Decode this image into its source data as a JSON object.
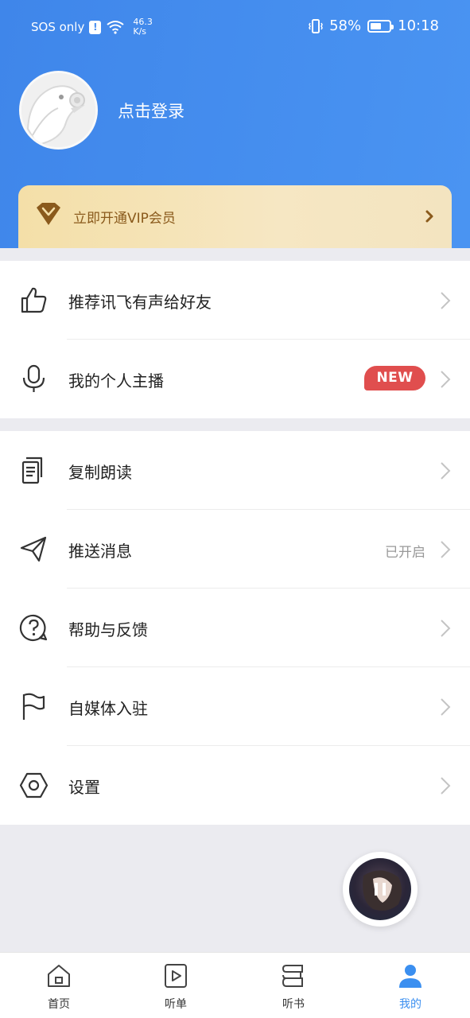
{
  "statusbar": {
    "carrier": "SOS only",
    "alert": "!",
    "speed_value": "46.3",
    "speed_unit": "K/s",
    "battery": "58%",
    "battery_level": 0.58,
    "time": "10:18"
  },
  "profile": {
    "login_label": "点击登录"
  },
  "vip": {
    "label": "立即开通VIP会员"
  },
  "group1": [
    {
      "label": "推荐讯飞有声给好友",
      "icon": "thumbs-up-icon"
    },
    {
      "label": "我的个人主播",
      "icon": "microphone-icon",
      "badge": "NEW"
    }
  ],
  "group2": [
    {
      "label": "复制朗读",
      "icon": "document-copy-icon"
    },
    {
      "label": "推送消息",
      "icon": "paper-plane-icon",
      "status": "已开启"
    },
    {
      "label": "帮助与反馈",
      "icon": "help-question-icon"
    },
    {
      "label": "自媒体入驻",
      "icon": "flag-icon"
    },
    {
      "label": "设置",
      "icon": "settings-hexagon-icon"
    }
  ],
  "tabs": [
    {
      "label": "首页",
      "icon": "home-icon"
    },
    {
      "label": "听单",
      "icon": "play-list-icon"
    },
    {
      "label": "听书",
      "icon": "book-icon"
    },
    {
      "label": "我的",
      "icon": "profile-icon",
      "active": true
    }
  ],
  "colors": {
    "header": "#4a8ff0",
    "accent": "#3b8ff0",
    "badge": "#e04e4e",
    "vip_text": "#8a5a1c"
  }
}
